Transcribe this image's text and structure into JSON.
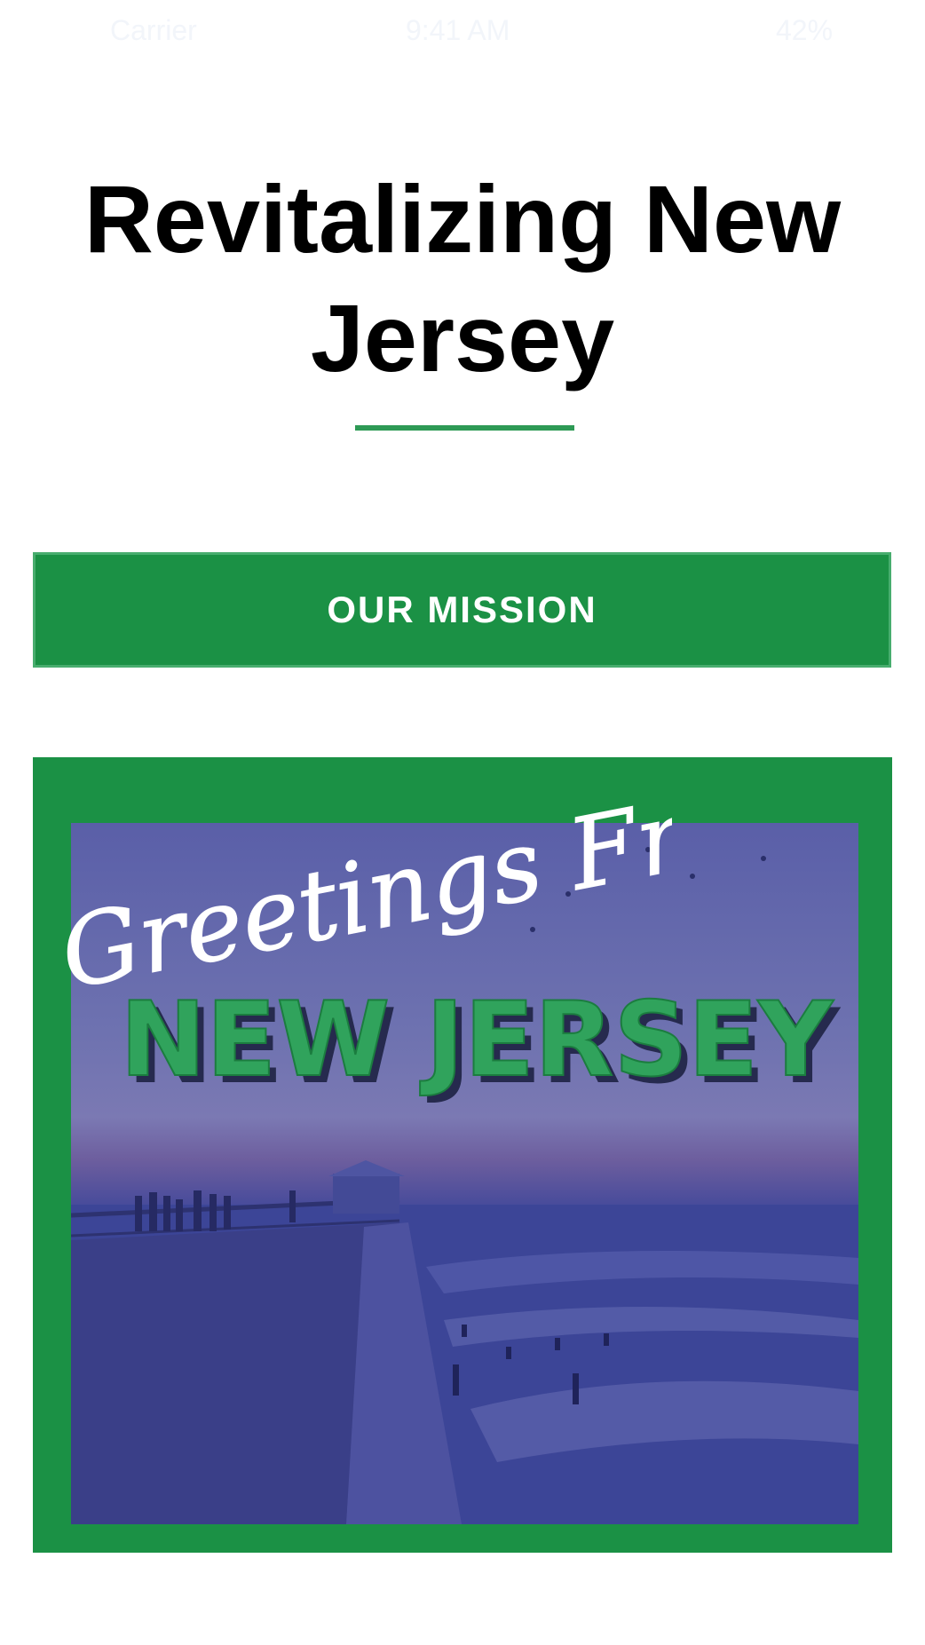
{
  "status_bar": {
    "carrier": "Carrier",
    "time": "9:41 AM",
    "battery": "42%"
  },
  "header": {
    "title": "Revitalizing New Jersey"
  },
  "mission_button": {
    "label": "OUR MISSION"
  },
  "postcard": {
    "greeting": "Greetings From",
    "state": "NEW JERSEY"
  },
  "colors": {
    "brand_green": "#1b9145",
    "divider_green": "#2e9a55",
    "overlay_blue": "#3b4392"
  }
}
